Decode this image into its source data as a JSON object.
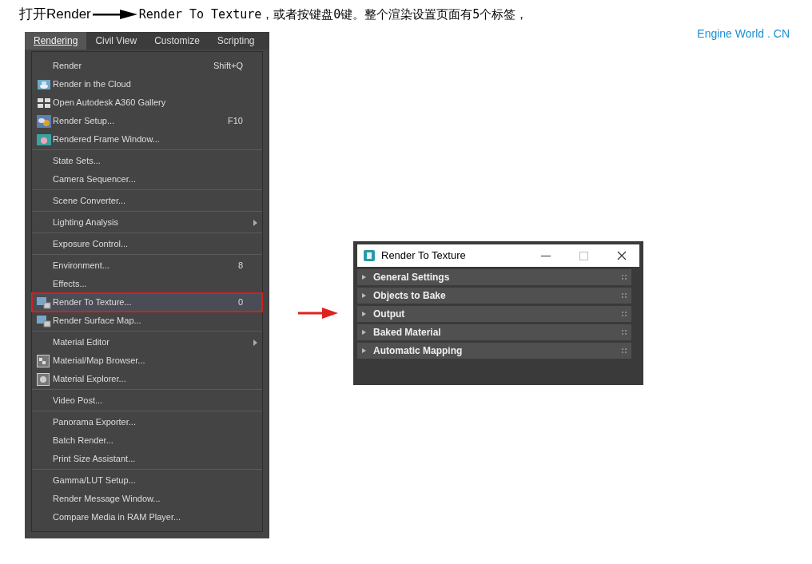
{
  "heading": {
    "before_arrow": "打开Render",
    "after_arrow": "Render To Texture，或者按键盘0键。整个渲染设置页面有5个标签，"
  },
  "site_label": "Engine World . CN",
  "menu_screenshot": {
    "menubar": [
      {
        "label": "Rendering",
        "selected": true
      },
      {
        "label": "Civil View",
        "selected": false
      },
      {
        "label": "Customize",
        "selected": false
      },
      {
        "label": "Scripting",
        "selected": false
      }
    ],
    "groups": [
      [
        {
          "label": "Render",
          "shortcut": "Shift+Q",
          "kind": "plain",
          "submenu": false,
          "highlighted": false
        },
        {
          "label": "Render in the Cloud",
          "kind": "cloud",
          "submenu": false,
          "highlighted": false
        },
        {
          "label": "Open Autodesk A360 Gallery",
          "kind": "gallery",
          "submenu": false,
          "highlighted": false
        },
        {
          "label": "Render Setup...",
          "shortcut": "F10",
          "kind": "setup",
          "submenu": false,
          "highlighted": false
        },
        {
          "label": "Rendered Frame Window...",
          "kind": "frame",
          "submenu": false,
          "highlighted": false
        }
      ],
      [
        {
          "label": "State Sets...",
          "kind": "plain",
          "submenu": false,
          "highlighted": false
        },
        {
          "label": "Camera Sequencer...",
          "kind": "plain",
          "submenu": false,
          "highlighted": false
        }
      ],
      [
        {
          "label": "Scene Converter...",
          "kind": "plain",
          "submenu": false,
          "highlighted": false
        }
      ],
      [
        {
          "label": "Lighting Analysis",
          "kind": "plain",
          "submenu": true,
          "highlighted": false
        }
      ],
      [
        {
          "label": "Exposure Control...",
          "kind": "plain",
          "submenu": false,
          "highlighted": false
        }
      ],
      [
        {
          "label": "Environment...",
          "shortcut": "8",
          "kind": "plain",
          "submenu": false,
          "highlighted": false
        },
        {
          "label": "Effects...",
          "kind": "plain",
          "submenu": false,
          "highlighted": false
        },
        {
          "label": "Render To Texture...",
          "shortcut": "0",
          "kind": "texture",
          "submenu": false,
          "highlighted": true
        },
        {
          "label": "Render Surface Map...",
          "kind": "texture",
          "submenu": false,
          "highlighted": false
        }
      ],
      [
        {
          "label": "Material Editor",
          "kind": "plain",
          "submenu": true,
          "highlighted": false
        },
        {
          "label": "Material/Map Browser...",
          "kind": "browser",
          "submenu": false,
          "highlighted": false
        },
        {
          "label": "Material Explorer...",
          "kind": "explorer",
          "submenu": false,
          "highlighted": false
        }
      ],
      [
        {
          "label": "Video Post...",
          "kind": "plain",
          "submenu": false,
          "highlighted": false
        }
      ],
      [
        {
          "label": "Panorama Exporter...",
          "kind": "plain",
          "submenu": false,
          "highlighted": false
        },
        {
          "label": "Batch Render...",
          "kind": "plain",
          "submenu": false,
          "highlighted": false
        },
        {
          "label": "Print Size Assistant...",
          "kind": "plain",
          "submenu": false,
          "highlighted": false
        }
      ],
      [
        {
          "label": "Gamma/LUT Setup...",
          "kind": "plain",
          "submenu": false,
          "highlighted": false
        },
        {
          "label": "Render Message Window...",
          "kind": "plain",
          "submenu": false,
          "highlighted": false
        },
        {
          "label": "Compare Media in RAM Player...",
          "kind": "plain",
          "submenu": false,
          "highlighted": false
        }
      ]
    ]
  },
  "dialog": {
    "title": "Render To Texture",
    "rollouts": [
      {
        "label": "General Settings",
        "expanded": false
      },
      {
        "label": "Objects to Bake",
        "expanded": false
      },
      {
        "label": "Output",
        "expanded": false
      },
      {
        "label": "Baked Material",
        "expanded": false
      },
      {
        "label": "Automatic Mapping",
        "expanded": false
      }
    ]
  }
}
